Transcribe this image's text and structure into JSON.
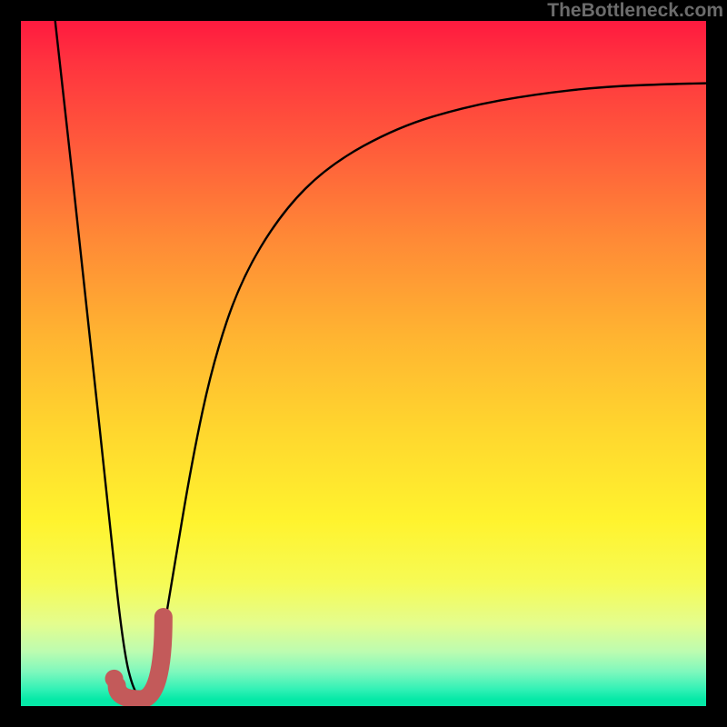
{
  "watermark": "TheBottleneck.com",
  "chart_data": {
    "type": "line",
    "title": "",
    "xlabel": "",
    "ylabel": "",
    "xlim": [
      0,
      100
    ],
    "ylim": [
      0,
      100
    ],
    "series": [
      {
        "name": "bottleneck-curve",
        "x": [
          5,
          10,
          13,
          15,
          16.5,
          18,
          20,
          22,
          25,
          28,
          32,
          38,
          45,
          55,
          65,
          75,
          85,
          95,
          100
        ],
        "values": [
          100,
          55,
          26,
          8,
          2,
          1,
          6,
          18,
          36,
          50,
          62,
          72,
          79,
          84.5,
          87.5,
          89.3,
          90.4,
          90.8,
          90.9
        ]
      }
    ],
    "marker": {
      "name": "selected-hardware-arc",
      "x_start": 14.0,
      "x_end": 20.8,
      "baseline_value": 1.0,
      "arc_start_value": 3.0,
      "arc_end_value": 13.0
    },
    "marker_point": {
      "name": "selected-hardware-dot",
      "x": 13.6,
      "value": 4.0
    },
    "gradient": {
      "top_color": "#ff1a3f",
      "bottom_color": "#06e9a7"
    }
  }
}
